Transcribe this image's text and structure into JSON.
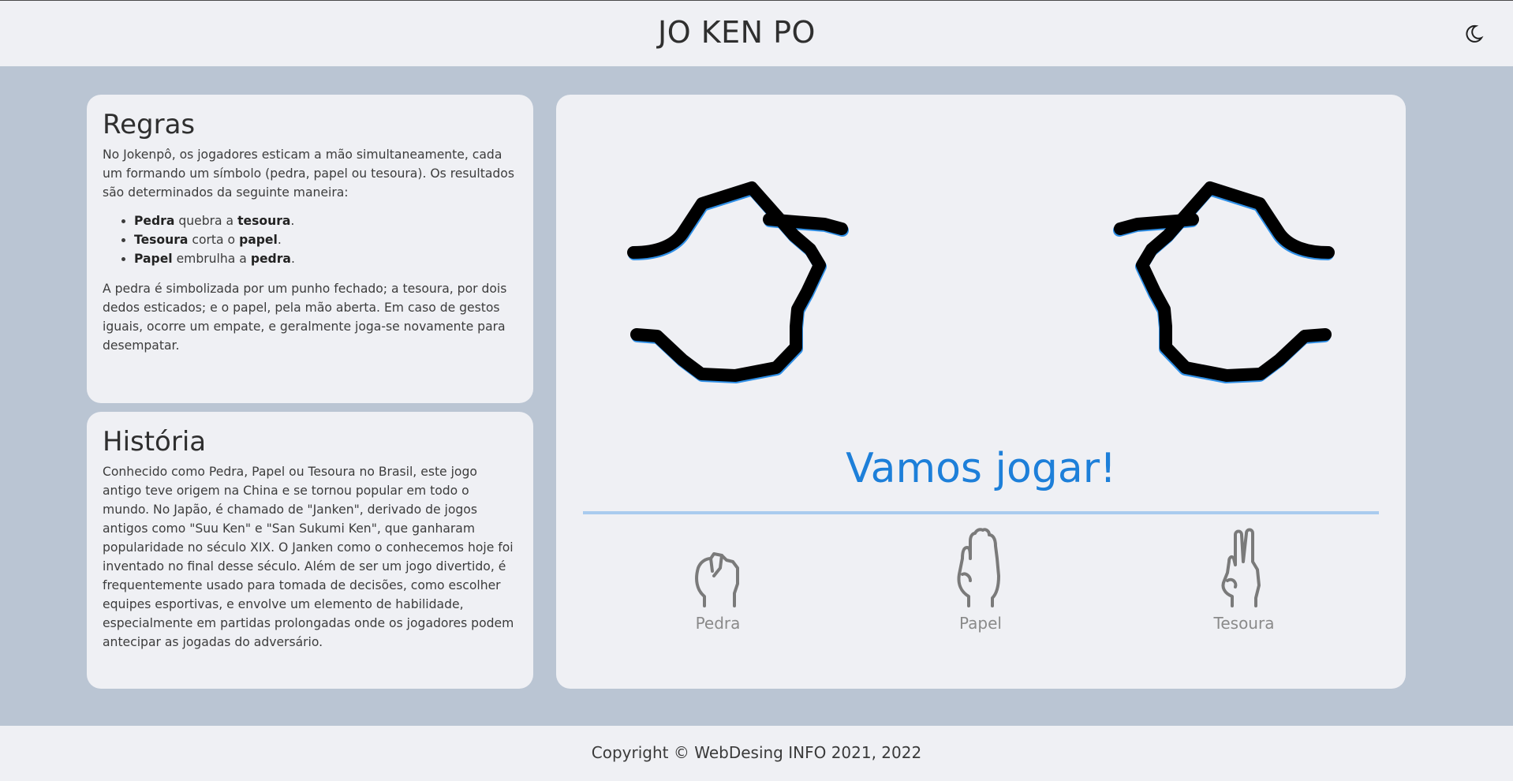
{
  "header": {
    "title": "JO KEN PO",
    "theme_icon": "moon-icon"
  },
  "rules": {
    "heading": "Regras",
    "intro": "No Jokenpô, os jogadores esticam a mão simultaneamente, cada um formando um símbolo (pedra, papel ou tesoura). Os resultados são determinados da seguinte maneira:",
    "items": [
      {
        "a": "Pedra",
        "verb": " quebra a ",
        "b": "tesoura",
        "end": "."
      },
      {
        "a": "Tesoura",
        "verb": " corta o ",
        "b": "papel",
        "end": "."
      },
      {
        "a": "Papel",
        "verb": " embrulha a ",
        "b": "pedra",
        "end": "."
      }
    ],
    "outro": "A pedra é simbolizada por um punho fechado; a tesoura, por dois dedos esticados; e o papel, pela mão aberta. Em caso de gestos iguais, ocorre um empate, e geralmente joga-se novamente para desempatar."
  },
  "history": {
    "heading": "História",
    "text": "Conhecido como Pedra, Papel ou Tesoura no Brasil, este jogo antigo teve origem na China e se tornou popular em todo o mundo. No Japão, é chamado de \"Janken\", derivado de jogos antigos como \"Suu Ken\" e \"San Sukumi Ken\", que ganharam popularidade no século XIX. O Janken como o conhecemos hoje foi inventado no final desse século. Além de ser um jogo divertido, é frequentemente usado para tomada de decisões, como escolher equipes esportivas, e envolve um elemento de habilidade, especialmente em partidas prolongadas onde os jogadores podem antecipar as jogadas do adversário."
  },
  "game": {
    "status": "Vamos jogar!",
    "accent": "#1d7fd9",
    "choices": [
      {
        "label": "Pedra",
        "icon": "rock-hand-icon"
      },
      {
        "label": "Papel",
        "icon": "paper-hand-icon"
      },
      {
        "label": "Tesoura",
        "icon": "scissors-hand-icon"
      }
    ]
  },
  "footer": {
    "copyright": "Copyright © WebDesing INFO 2021, 2022"
  }
}
